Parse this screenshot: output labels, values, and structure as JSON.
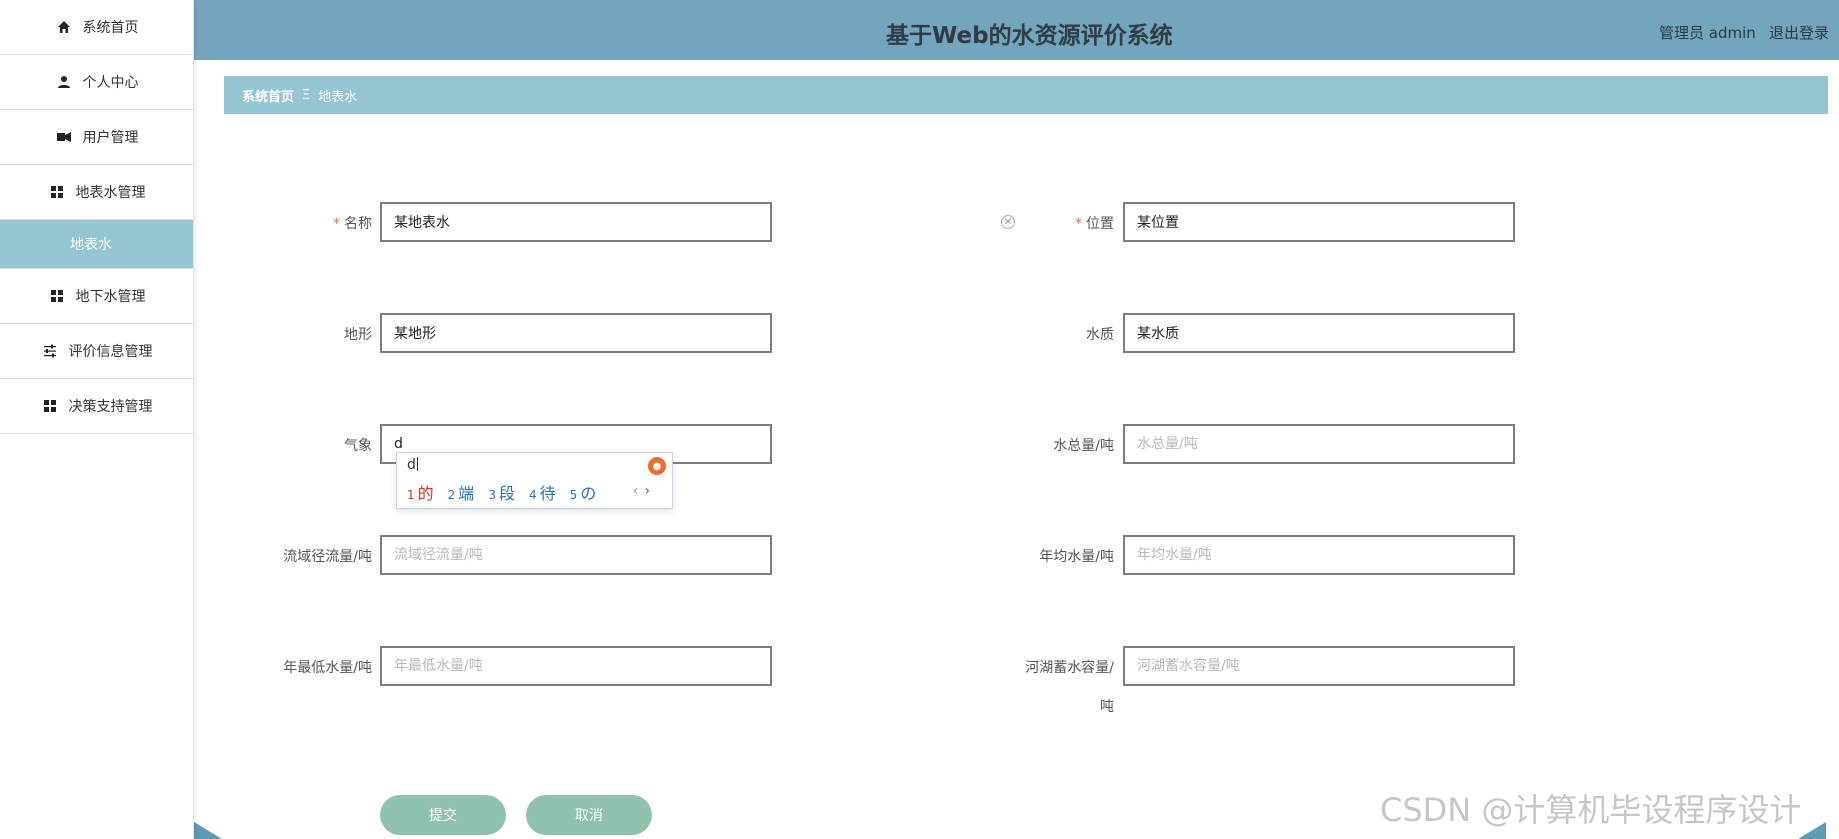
{
  "header": {
    "title": "基于Web的水资源评价系统",
    "user_label": "管理员 admin",
    "logout_label": "退出登录"
  },
  "sidebar": {
    "items": [
      {
        "label": "系统首页",
        "icon": "home-icon"
      },
      {
        "label": "个人中心",
        "icon": "user-icon"
      },
      {
        "label": "用户管理",
        "icon": "users-icon"
      },
      {
        "label": "地表水管理",
        "icon": "grid-icon"
      },
      {
        "label": "地表水",
        "icon": ""
      },
      {
        "label": "地下水管理",
        "icon": "grid-icon"
      },
      {
        "label": "评价信息管理",
        "icon": "sliders-icon"
      },
      {
        "label": "决策支持管理",
        "icon": "grid-icon"
      }
    ]
  },
  "breadcrumb": {
    "home": "系统首页",
    "separator": "Ξ",
    "current": "地表水"
  },
  "form": {
    "name": {
      "label": "名称",
      "value": "某地表水",
      "required": true
    },
    "location": {
      "label": "位置",
      "value": "某位置",
      "required": true
    },
    "terrain": {
      "label": "地形",
      "value": "某地形"
    },
    "water_quality": {
      "label": "水质",
      "value": "某水质"
    },
    "weather": {
      "label": "气象",
      "value": "d"
    },
    "total_water": {
      "label": "水总量/吨",
      "placeholder": "水总量/吨"
    },
    "runoff": {
      "label": "流域径流量/吨",
      "placeholder": "流域径流量/吨"
    },
    "annual_avg": {
      "label": "年均水量/吨",
      "placeholder": "年均水量/吨"
    },
    "annual_min": {
      "label": "年最低水量/吨",
      "placeholder": "年最低水量/吨"
    },
    "lake_storage": {
      "label_line1": "河湖蓄水容量/",
      "label_line2": "吨",
      "placeholder": "河湖蓄水容量/吨"
    },
    "submit_label": "提交",
    "cancel_label": "取消"
  },
  "ime": {
    "typed": "d",
    "candidates": [
      {
        "num": "1",
        "text": "的"
      },
      {
        "num": "2",
        "text": "端"
      },
      {
        "num": "3",
        "text": "段"
      },
      {
        "num": "4",
        "text": "待"
      },
      {
        "num": "5",
        "text": "の"
      }
    ]
  },
  "watermark": "CSDN @计算机毕设程序设计"
}
